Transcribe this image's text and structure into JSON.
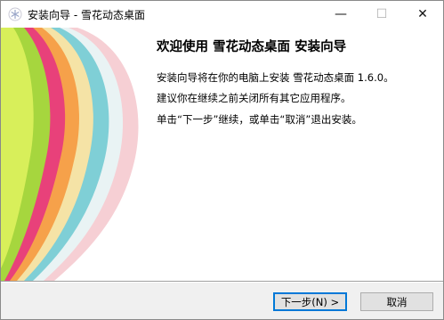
{
  "window": {
    "title": "安装向导 - 雪花动态桌面",
    "minimize_glyph": "—",
    "maximize_glyph": "☐",
    "close_glyph": "✕",
    "app_icon": "snowflake-icon"
  },
  "content": {
    "heading": "欢迎使用 雪花动态桌面 安装向导",
    "paragraphs": [
      "安装向导将在你的电脑上安装 雪花动态桌面 1.6.0。",
      "建议你在继续之前关闭所有其它应用程序。",
      "单击“下一步”继续，或单击“取消”退出安装。"
    ]
  },
  "buttons": {
    "next": "下一步(N) >",
    "cancel": "取消"
  },
  "colors": {
    "accent": "#0078d7",
    "button_bg": "#e1e1e1",
    "panel_bg": "#ffffff"
  }
}
